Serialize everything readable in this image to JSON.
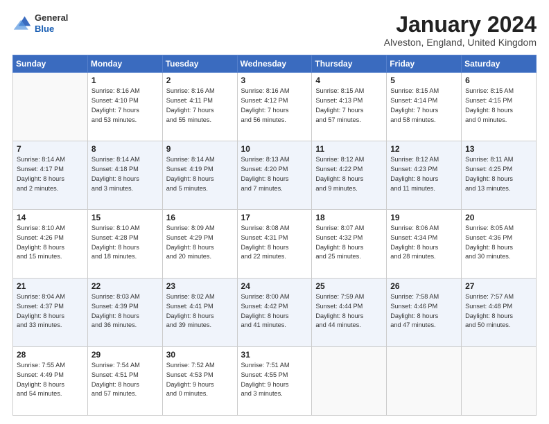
{
  "header": {
    "logo_general": "General",
    "logo_blue": "Blue",
    "month_title": "January 2024",
    "location": "Alveston, England, United Kingdom"
  },
  "days_of_week": [
    "Sunday",
    "Monday",
    "Tuesday",
    "Wednesday",
    "Thursday",
    "Friday",
    "Saturday"
  ],
  "weeks": [
    [
      {
        "day": "",
        "info": ""
      },
      {
        "day": "1",
        "info": "Sunrise: 8:16 AM\nSunset: 4:10 PM\nDaylight: 7 hours\nand 53 minutes."
      },
      {
        "day": "2",
        "info": "Sunrise: 8:16 AM\nSunset: 4:11 PM\nDaylight: 7 hours\nand 55 minutes."
      },
      {
        "day": "3",
        "info": "Sunrise: 8:16 AM\nSunset: 4:12 PM\nDaylight: 7 hours\nand 56 minutes."
      },
      {
        "day": "4",
        "info": "Sunrise: 8:15 AM\nSunset: 4:13 PM\nDaylight: 7 hours\nand 57 minutes."
      },
      {
        "day": "5",
        "info": "Sunrise: 8:15 AM\nSunset: 4:14 PM\nDaylight: 7 hours\nand 58 minutes."
      },
      {
        "day": "6",
        "info": "Sunrise: 8:15 AM\nSunset: 4:15 PM\nDaylight: 8 hours\nand 0 minutes."
      }
    ],
    [
      {
        "day": "7",
        "info": "Sunrise: 8:14 AM\nSunset: 4:17 PM\nDaylight: 8 hours\nand 2 minutes."
      },
      {
        "day": "8",
        "info": "Sunrise: 8:14 AM\nSunset: 4:18 PM\nDaylight: 8 hours\nand 3 minutes."
      },
      {
        "day": "9",
        "info": "Sunrise: 8:14 AM\nSunset: 4:19 PM\nDaylight: 8 hours\nand 5 minutes."
      },
      {
        "day": "10",
        "info": "Sunrise: 8:13 AM\nSunset: 4:20 PM\nDaylight: 8 hours\nand 7 minutes."
      },
      {
        "day": "11",
        "info": "Sunrise: 8:12 AM\nSunset: 4:22 PM\nDaylight: 8 hours\nand 9 minutes."
      },
      {
        "day": "12",
        "info": "Sunrise: 8:12 AM\nSunset: 4:23 PM\nDaylight: 8 hours\nand 11 minutes."
      },
      {
        "day": "13",
        "info": "Sunrise: 8:11 AM\nSunset: 4:25 PM\nDaylight: 8 hours\nand 13 minutes."
      }
    ],
    [
      {
        "day": "14",
        "info": "Sunrise: 8:10 AM\nSunset: 4:26 PM\nDaylight: 8 hours\nand 15 minutes."
      },
      {
        "day": "15",
        "info": "Sunrise: 8:10 AM\nSunset: 4:28 PM\nDaylight: 8 hours\nand 18 minutes."
      },
      {
        "day": "16",
        "info": "Sunrise: 8:09 AM\nSunset: 4:29 PM\nDaylight: 8 hours\nand 20 minutes."
      },
      {
        "day": "17",
        "info": "Sunrise: 8:08 AM\nSunset: 4:31 PM\nDaylight: 8 hours\nand 22 minutes."
      },
      {
        "day": "18",
        "info": "Sunrise: 8:07 AM\nSunset: 4:32 PM\nDaylight: 8 hours\nand 25 minutes."
      },
      {
        "day": "19",
        "info": "Sunrise: 8:06 AM\nSunset: 4:34 PM\nDaylight: 8 hours\nand 28 minutes."
      },
      {
        "day": "20",
        "info": "Sunrise: 8:05 AM\nSunset: 4:36 PM\nDaylight: 8 hours\nand 30 minutes."
      }
    ],
    [
      {
        "day": "21",
        "info": "Sunrise: 8:04 AM\nSunset: 4:37 PM\nDaylight: 8 hours\nand 33 minutes."
      },
      {
        "day": "22",
        "info": "Sunrise: 8:03 AM\nSunset: 4:39 PM\nDaylight: 8 hours\nand 36 minutes."
      },
      {
        "day": "23",
        "info": "Sunrise: 8:02 AM\nSunset: 4:41 PM\nDaylight: 8 hours\nand 39 minutes."
      },
      {
        "day": "24",
        "info": "Sunrise: 8:00 AM\nSunset: 4:42 PM\nDaylight: 8 hours\nand 41 minutes."
      },
      {
        "day": "25",
        "info": "Sunrise: 7:59 AM\nSunset: 4:44 PM\nDaylight: 8 hours\nand 44 minutes."
      },
      {
        "day": "26",
        "info": "Sunrise: 7:58 AM\nSunset: 4:46 PM\nDaylight: 8 hours\nand 47 minutes."
      },
      {
        "day": "27",
        "info": "Sunrise: 7:57 AM\nSunset: 4:48 PM\nDaylight: 8 hours\nand 50 minutes."
      }
    ],
    [
      {
        "day": "28",
        "info": "Sunrise: 7:55 AM\nSunset: 4:49 PM\nDaylight: 8 hours\nand 54 minutes."
      },
      {
        "day": "29",
        "info": "Sunrise: 7:54 AM\nSunset: 4:51 PM\nDaylight: 8 hours\nand 57 minutes."
      },
      {
        "day": "30",
        "info": "Sunrise: 7:52 AM\nSunset: 4:53 PM\nDaylight: 9 hours\nand 0 minutes."
      },
      {
        "day": "31",
        "info": "Sunrise: 7:51 AM\nSunset: 4:55 PM\nDaylight: 9 hours\nand 3 minutes."
      },
      {
        "day": "",
        "info": ""
      },
      {
        "day": "",
        "info": ""
      },
      {
        "day": "",
        "info": ""
      }
    ]
  ]
}
